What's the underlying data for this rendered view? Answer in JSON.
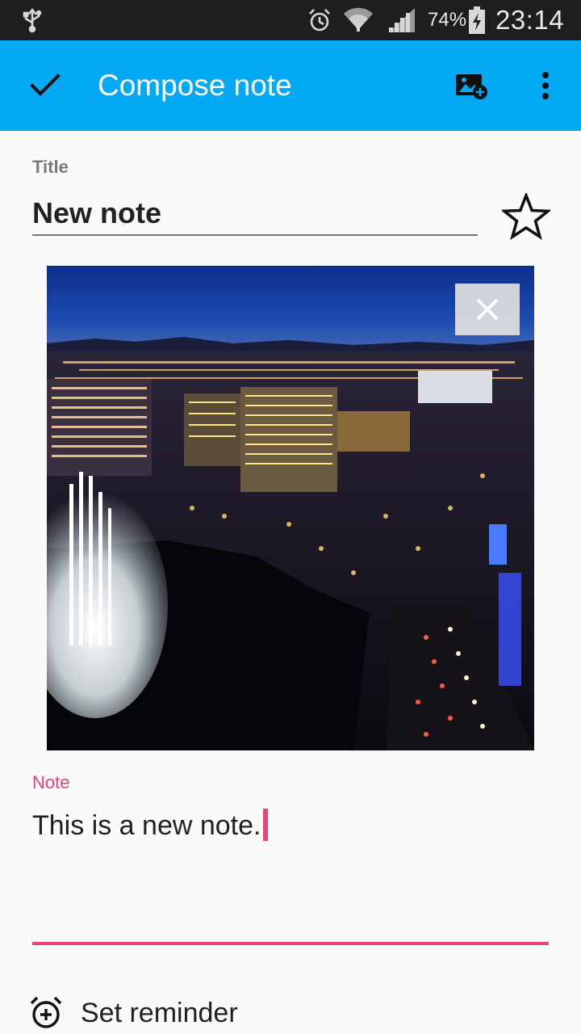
{
  "status_bar": {
    "battery_percent": "74%",
    "time": "23:14",
    "icons": [
      "usb-icon",
      "alarm-icon",
      "wifi-icon",
      "signal-icon",
      "battery-charging-icon"
    ]
  },
  "toolbar": {
    "title": "Compose note",
    "background_color": "#03a9f4",
    "icons": [
      "check-icon",
      "add-image-icon",
      "more-vert-icon"
    ]
  },
  "title_field": {
    "label": "Title",
    "value": "New note"
  },
  "favorite": {
    "icon": "star-outline-icon",
    "active": false
  },
  "photo": {
    "remove_icon": "close-icon"
  },
  "note_field": {
    "label": "Note",
    "value": "This is a new note.",
    "accent_color": "#ec407a"
  },
  "reminder": {
    "label": "Set reminder",
    "icon": "alarm-add-icon"
  }
}
